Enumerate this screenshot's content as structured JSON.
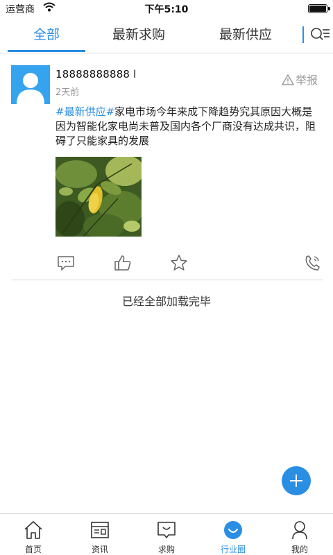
{
  "status_bar": {
    "carrier": "运营商",
    "time": "下午5:10"
  },
  "tabs": [
    {
      "label": "全部",
      "active": true
    },
    {
      "label": "最新求购",
      "active": false
    },
    {
      "label": "最新供应",
      "active": false
    }
  ],
  "post": {
    "username": "18888888888 l",
    "time_ago": "2天前",
    "report_label": "举报",
    "tag": "#最新供应#",
    "content": "家电市场今年来成下降趋势究其原因大概是因为智能化家电尚未普及国内各个厂商没有达成共识，阻碍了只能家具的发展"
  },
  "load_status": "已经全部加载完毕",
  "bottom_nav": [
    {
      "label": "首页",
      "icon": "home-icon",
      "active": false
    },
    {
      "label": "资讯",
      "icon": "news-icon",
      "active": false
    },
    {
      "label": "求购",
      "icon": "purchase-icon",
      "active": false
    },
    {
      "label": "行业圈",
      "icon": "industry-circle-icon",
      "active": true
    },
    {
      "label": "我的",
      "icon": "profile-icon",
      "active": false
    }
  ],
  "colors": {
    "accent": "#2a8ee3",
    "muted": "#999999"
  }
}
